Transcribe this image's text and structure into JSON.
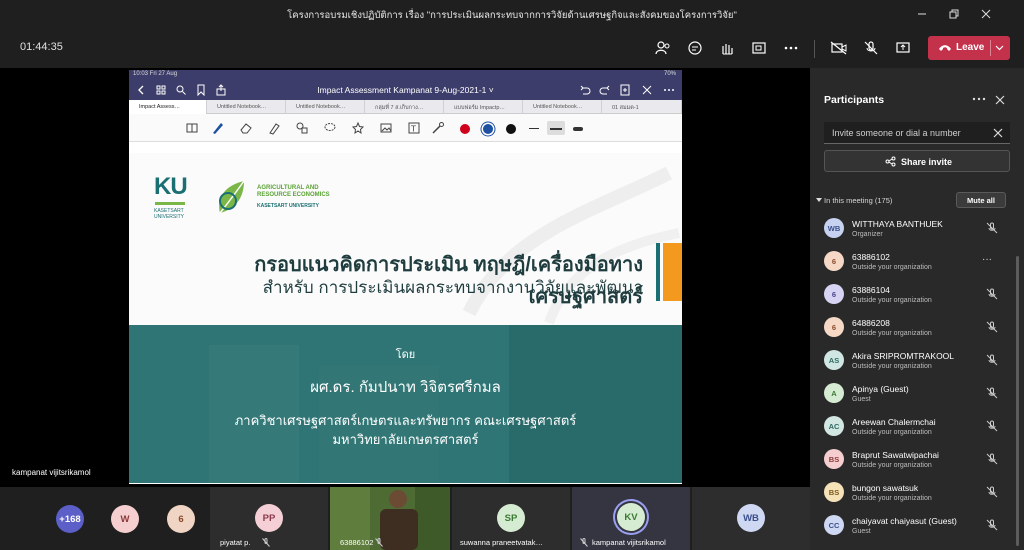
{
  "window": {
    "title": "โครงการอบรมเชิงปฏิบัติการ เรื่อง \"การประเมินผลกระทบจากการวิจัยด้านเศรษฐกิจและสังคมของโครงการวิจัย\""
  },
  "meeting": {
    "timer": "01:44:35",
    "leave_label": "Leave"
  },
  "stage": {
    "presenter_name": "kampanat vijitsrikamol"
  },
  "ipad": {
    "status_time": "10:03  Fri 27 Aug",
    "status_right": "70%",
    "doc_title": "Impact Assessment Kampanat 9-Aug-2021-1 ˅",
    "tabs": [
      {
        "label": "Impact Assess…"
      },
      {
        "label": "Untitled Notebook…"
      },
      {
        "label": "Untitled Notebook…"
      },
      {
        "label": "กลุ่มที่ 7 ส.เก็บกาง…"
      },
      {
        "label": "แบบฟอร์ม Impactp…"
      },
      {
        "label": "Untitled Notebook…"
      },
      {
        "label": "01 สมมต-1"
      }
    ],
    "pen_colors": [
      "#d0021b",
      "#1e50a2",
      "#111111"
    ]
  },
  "slide": {
    "ku_logo": "KU",
    "ku_sub_1": "KASETSART",
    "ku_sub_2": "UNIVERSITY",
    "are_line1": "AGRICULTURAL AND",
    "are_line2": "RESOURCE ECONOMICS",
    "are_uni": "KASETSART UNIVERSITY",
    "heading": "กรอบแนวคิดการประเมิน ทฤษฎี/เครื่องมือทางเศรษฐศาสตร์",
    "subheading": "สำหรับ การประเมินผลกระทบจากงานวิจัยและพัฒนา",
    "by": "โดย",
    "author": "ผศ.ดร. กัมปนาท วิจิตรศรีกมล",
    "dept1": "ภาควิชาเศรษฐศาสตร์เกษตรและทรัพยากร คณะเศรษฐศาสตร์",
    "dept2": "มหาวิทยาลัยเกษตรศาสตร์",
    "colors": {
      "teal": "#1a6f72",
      "orange": "#f39a1e",
      "green": "#5aa334"
    }
  },
  "participants_panel": {
    "title": "Participants",
    "invite_placeholder": "Invite someone or dial a number",
    "share_invite": "Share invite",
    "in_meeting_label": "In this meeting (175)",
    "mute_all": "Mute all",
    "list": [
      {
        "initials": "WB",
        "name": "WITTHAYA BANTHUEK",
        "role": "Organizer",
        "bg": "#c6d2f0",
        "fg": "#3a4f8c"
      },
      {
        "initials": "6",
        "name": "63886102",
        "role": "Outside your organization",
        "bg": "#f6d8c6",
        "fg": "#8a4b2a"
      },
      {
        "initials": "6",
        "name": "63886104",
        "role": "Outside your organization",
        "bg": "#d6d4f2",
        "fg": "#4a468c"
      },
      {
        "initials": "6",
        "name": "64886208",
        "role": "Outside your organization",
        "bg": "#f6d8c6",
        "fg": "#8a4b2a"
      },
      {
        "initials": "AS",
        "name": "Akira SRIPROMTRAKOOL",
        "role": "Outside your organization",
        "bg": "#cfe6e2",
        "fg": "#2f6b63"
      },
      {
        "initials": "A",
        "name": "Apinya (Guest)",
        "role": "Guest",
        "bg": "#d6ecd2",
        "fg": "#3a7a33"
      },
      {
        "initials": "AC",
        "name": "Areewan Chalermchai",
        "role": "Outside your organization",
        "bg": "#d2e6e2",
        "fg": "#2f6b63"
      },
      {
        "initials": "BS",
        "name": "Braprut Sawatwipachai",
        "role": "Outside your organization",
        "bg": "#f5cfcf",
        "fg": "#8c3a3a"
      },
      {
        "initials": "BS",
        "name": "bungon sawatsuk",
        "role": "Outside your organization",
        "bg": "#f6e2b8",
        "fg": "#7a5a1a"
      },
      {
        "initials": "CC",
        "name": "chaiyavat chaiyasut (Guest)",
        "role": "Guest",
        "bg": "#cfd8f2",
        "fg": "#3a4f8c"
      }
    ]
  },
  "gallery": {
    "overflow_count": "+168",
    "tiles": [
      {
        "initials": "W",
        "bg": "#f5cfcf",
        "fg": "#8c3a3a",
        "name": ""
      },
      {
        "initials": "6",
        "bg": "#f0d4c4",
        "fg": "#8a4b2a",
        "name": ""
      },
      {
        "initials": "PP",
        "bg": "#f5cfd6",
        "fg": "#8c3a4c",
        "name": "piyatat p."
      },
      {
        "initials": "",
        "bg": "",
        "fg": "",
        "name": "63886102"
      },
      {
        "initials": "SP",
        "bg": "#d6ecd2",
        "fg": "#3a7a33",
        "name": "suwanna praneetvatak…"
      },
      {
        "initials": "KV",
        "bg": "#d6ecd2",
        "fg": "#3a7a33",
        "name": "kampanat vijitsrikamol"
      },
      {
        "initials": "WB",
        "bg": "#cfd8f2",
        "fg": "#3a4f8c",
        "name": ""
      }
    ]
  }
}
